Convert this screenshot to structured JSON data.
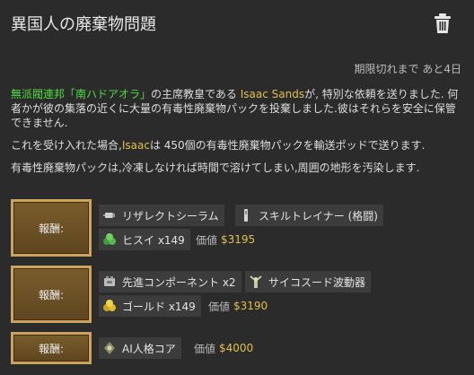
{
  "header": {
    "title": "異国人の廃棄物問題",
    "expiry": "期限切れまで あと4日"
  },
  "description": {
    "p1_faction": "無派閥連邦「南ハドアオラ」",
    "p1_text1": "の主席教皇である ",
    "p1_person": "Isaac Sands",
    "p1_text2": "が, 特別な依頼を送りました. 何者かが彼の集落の近くに大量の有毒性廃棄物パックを投棄しました.彼はそれらを安全に保管できません.",
    "p2_text1": "これを受け入れた場合,",
    "p2_person": "Isaac",
    "p2_text2": "は 450個の有毒性廃棄物パックを輸送ポッドで送ります.",
    "p3_text": "有毒性廃棄物パックは,冷凍しなければ時間で溶けてしまい,周囲の地形を汚染します."
  },
  "rewards": [
    {
      "button_label": "報酬:",
      "items": [
        {
          "label": "リザレクトシーラム",
          "icon": "serum-icon"
        },
        {
          "label": "スキルトレイナー (格闘)",
          "icon": "skill-trainer-icon"
        },
        {
          "label": "ヒスイ x149",
          "icon": "jade-icon"
        }
      ],
      "value_label": "価値",
      "value_amount": "$3195"
    },
    {
      "button_label": "報酬:",
      "items": [
        {
          "label": "先進コンポーネント x2",
          "icon": "component-icon"
        },
        {
          "label": "サイコスード波動器",
          "icon": "psychic-soothe-icon"
        },
        {
          "label": "ゴールド x149",
          "icon": "gold-icon"
        }
      ],
      "value_label": "価値",
      "value_amount": "$3190"
    },
    {
      "button_label": "報酬:",
      "items": [
        {
          "label": "AI人格コア",
          "icon": "ai-core-icon"
        }
      ],
      "value_label": "価値",
      "value_amount": "$4000"
    }
  ],
  "colors": {
    "faction": "#4fdc3f",
    "person": "#e0c04a",
    "value": "#e0c04a",
    "button": "#7a5d2b",
    "button_border": "#c9a45a"
  }
}
